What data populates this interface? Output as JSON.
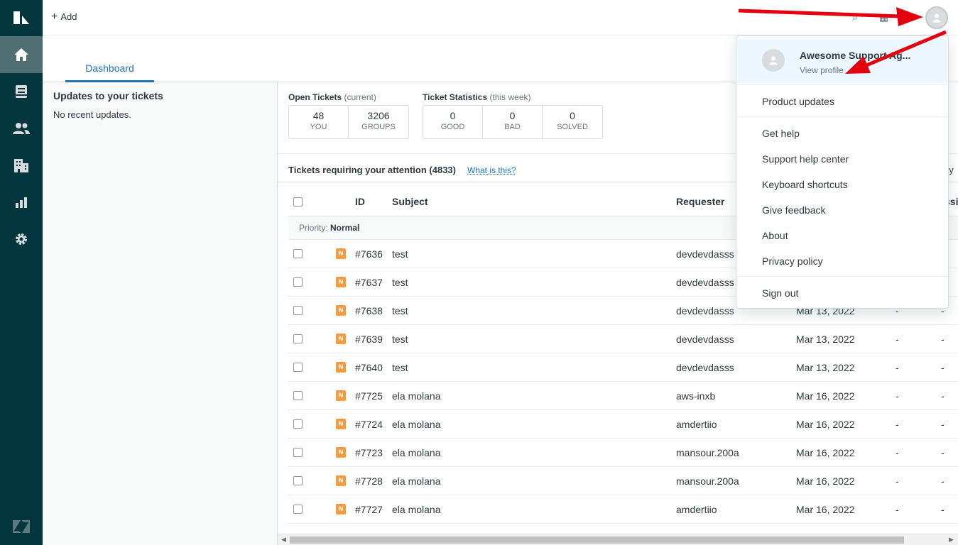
{
  "topbar": {
    "add_label": "Add"
  },
  "sidebar": {
    "items": [
      {
        "name": "home"
      },
      {
        "name": "views"
      },
      {
        "name": "customers"
      },
      {
        "name": "organizations"
      },
      {
        "name": "reporting"
      },
      {
        "name": "admin"
      }
    ]
  },
  "tabs": [
    {
      "label": "Dashboard"
    }
  ],
  "updates": {
    "title": "Updates to your tickets",
    "empty": "No recent updates."
  },
  "open_tickets": {
    "label": "Open Tickets",
    "sub": "(current)",
    "stats": [
      {
        "value": "48",
        "caption": "YOU"
      },
      {
        "value": "3206",
        "caption": "GROUPS"
      }
    ]
  },
  "ticket_stats": {
    "label": "Ticket Statistics",
    "sub": "(this week)",
    "stats": [
      {
        "value": "0",
        "caption": "GOOD"
      },
      {
        "value": "0",
        "caption": "BAD"
      },
      {
        "value": "0",
        "caption": "SOLVED"
      }
    ]
  },
  "attention": {
    "title": "Tickets requiring your attention (4833)",
    "link": "What is this?",
    "right_partial": "ay"
  },
  "table": {
    "headers": {
      "id": "ID",
      "subject": "Subject",
      "requester": "Requester",
      "partial": "ssi"
    },
    "group": {
      "label": "Priority:",
      "value": "Normal"
    },
    "priority_letter": "N",
    "rows": [
      {
        "id": "#7636",
        "subject": "test",
        "requester": "devdevdasss",
        "date": "",
        "c1": "",
        "c2": ""
      },
      {
        "id": "#7637",
        "subject": "test",
        "requester": "devdevdasss",
        "date": "",
        "c1": "",
        "c2": ""
      },
      {
        "id": "#7638",
        "subject": "test",
        "requester": "devdevdasss",
        "date": "Mar 13, 2022",
        "c1": "-",
        "c2": "-"
      },
      {
        "id": "#7639",
        "subject": "test",
        "requester": "devdevdasss",
        "date": "Mar 13, 2022",
        "c1": "-",
        "c2": "-"
      },
      {
        "id": "#7640",
        "subject": "test",
        "requester": "devdevdasss",
        "date": "Mar 13, 2022",
        "c1": "-",
        "c2": "-"
      },
      {
        "id": "#7725",
        "subject": "ela molana",
        "requester": "aws-inxb",
        "date": "Mar 16, 2022",
        "c1": "-",
        "c2": "-"
      },
      {
        "id": "#7724",
        "subject": "ela molana",
        "requester": "amdertiio",
        "date": "Mar 16, 2022",
        "c1": "-",
        "c2": "-"
      },
      {
        "id": "#7723",
        "subject": "ela molana",
        "requester": "mansour.200a",
        "date": "Mar 16, 2022",
        "c1": "-",
        "c2": "-"
      },
      {
        "id": "#7728",
        "subject": "ela molana",
        "requester": "mansour.200a",
        "date": "Mar 16, 2022",
        "c1": "-",
        "c2": "-"
      },
      {
        "id": "#7727",
        "subject": "ela molana",
        "requester": "amdertiio",
        "date": "Mar 16, 2022",
        "c1": "-",
        "c2": "-"
      }
    ]
  },
  "profile_menu": {
    "name": "Awesome Support Ag...",
    "view_profile": "View profile",
    "items": [
      "Product updates",
      "Get help",
      "Support help center",
      "Keyboard shortcuts",
      "Give feedback",
      "About",
      "Privacy policy",
      "Sign out"
    ]
  },
  "colors": {
    "sidebar": "#03363d",
    "accent": "#1f73b7",
    "priority_normal": "#f79a3e",
    "annotation": "#e3000f"
  }
}
